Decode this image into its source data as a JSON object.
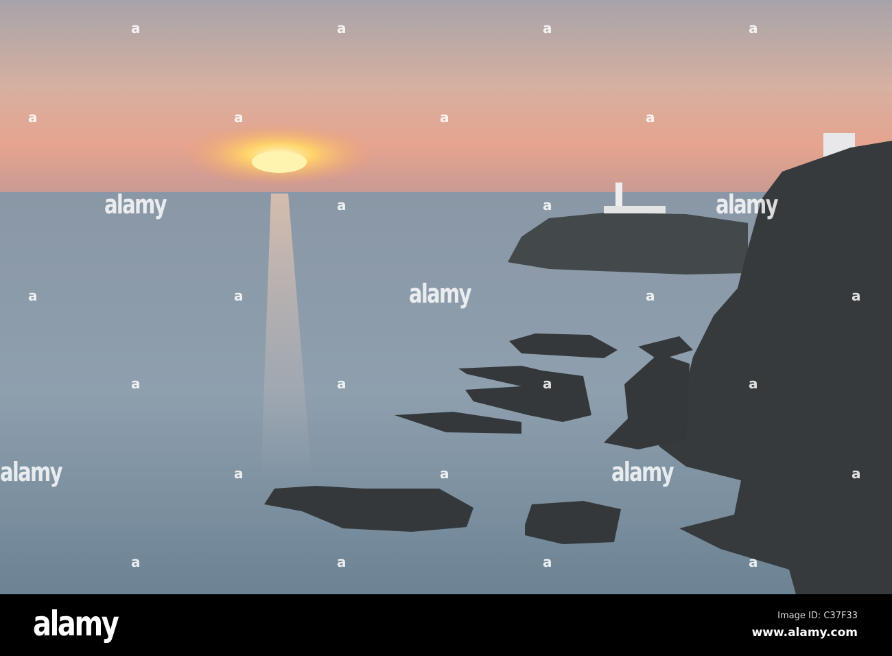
{
  "watermark": {
    "text": "alamy",
    "mark": "a"
  },
  "footer": {
    "logo": "alamy",
    "image_id": "Image ID: C37F33",
    "url": "www.alamy.com"
  },
  "colors": {
    "sky_top": "#a8a4ab",
    "sky_glow": "#e7a98f",
    "sea": "#8596a5",
    "rock": "#34383c"
  }
}
